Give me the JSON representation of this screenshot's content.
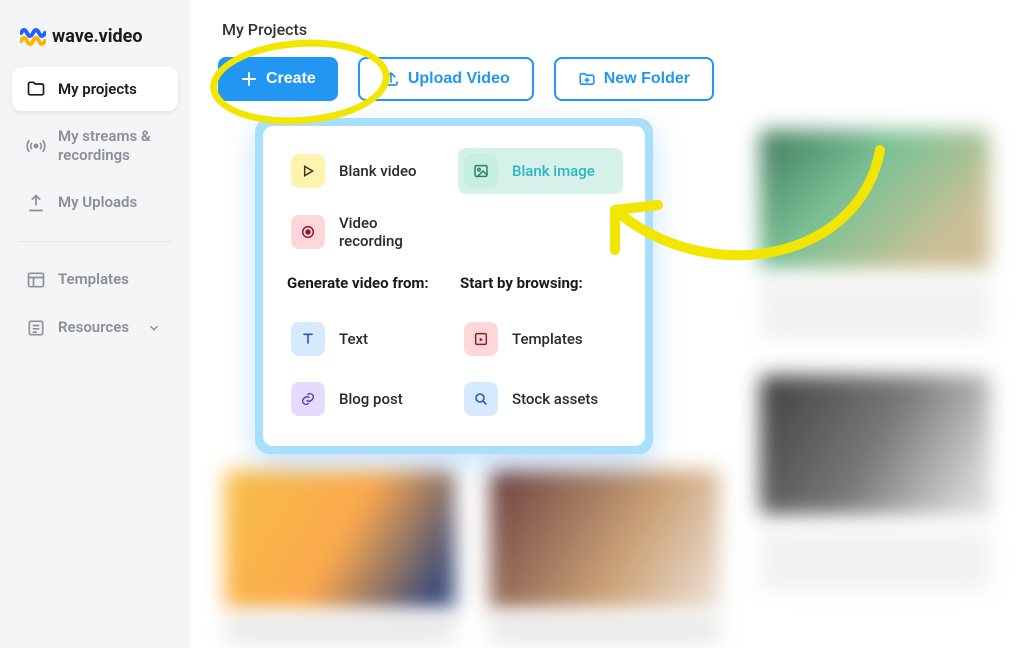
{
  "brand": "wave.video",
  "sidebar": {
    "items": [
      {
        "label": "My projects"
      },
      {
        "label": "My streams & recordings"
      },
      {
        "label": "My Uploads"
      },
      {
        "label": "Templates"
      },
      {
        "label": "Resources"
      }
    ]
  },
  "page": {
    "title": "My Projects"
  },
  "toolbar": {
    "create": "Create",
    "upload": "Upload Video",
    "new_folder": "New Folder"
  },
  "popover": {
    "blank_video": "Blank video",
    "blank_image": "Blank image",
    "video_recording": "Video recording",
    "generate_heading": "Generate video from:",
    "browse_heading": "Start by browsing:",
    "text": "Text",
    "templates": "Templates",
    "blog_post": "Blog post",
    "stock_assets": "Stock assets"
  },
  "colors": {
    "accent": "#2196f3",
    "highlight": "#f2e600"
  }
}
